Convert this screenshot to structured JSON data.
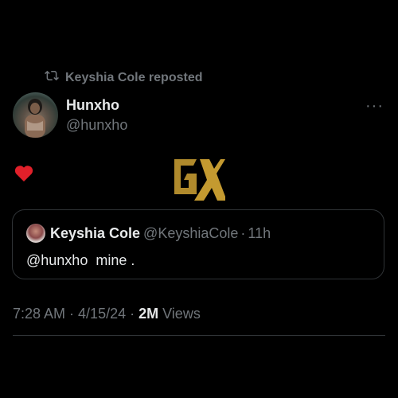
{
  "repost": {
    "label": "Keyshia Cole reposted",
    "icon": "repost-icon"
  },
  "author": {
    "name": "Hunxho",
    "handle": "@hunxho",
    "avatar": "avatar"
  },
  "more": {
    "label": "···",
    "icon": "more-icon"
  },
  "post": {
    "emoji": "heart-emoji"
  },
  "watermark": {
    "icon": "gx-logo"
  },
  "quote": {
    "name": "Keyshia Cole",
    "handle": "@KeyshiaCole",
    "separator": "·",
    "time": "11h",
    "text": "@hunxho  mine ."
  },
  "meta": {
    "time": "7:28 AM",
    "sep1": " · ",
    "date": "4/15/24",
    "sep2": " · ",
    "views_count": "2M",
    "views_label": " Views"
  },
  "colors": {
    "background": "#000000",
    "text": "#e7e9ea",
    "muted": "#71767b",
    "border": "#2f3336",
    "heart": "#f91880",
    "logo": "#b08a2c"
  }
}
